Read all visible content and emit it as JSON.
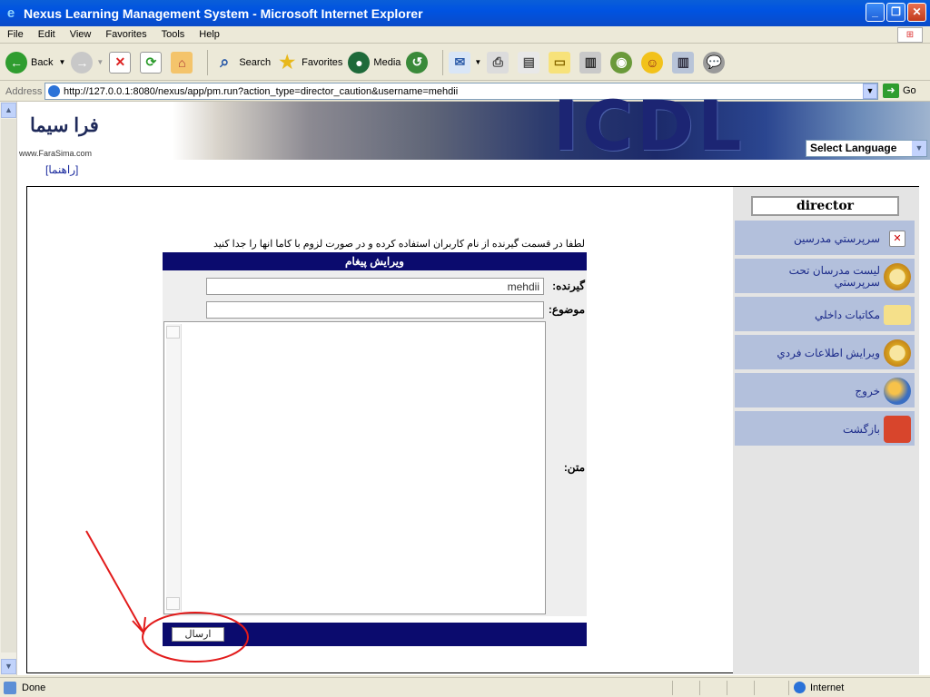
{
  "window": {
    "title": "Nexus Learning Management System - Microsoft Internet Explorer",
    "icon": "ie-icon"
  },
  "menu": [
    "File",
    "Edit",
    "View",
    "Favorites",
    "Tools",
    "Help"
  ],
  "toolbar": {
    "back": "Back",
    "search": "Search",
    "favorites": "Favorites",
    "media": "Media"
  },
  "address": {
    "label": "Address",
    "url": "http://127.0.0.1:8080/nexus/app/pm.run?action_type=director_caution&username=mehdii",
    "go": "Go"
  },
  "banner": {
    "logo_text": "فرا سیما",
    "logo_url": "www.FaraSima.com",
    "brand": "ICDL",
    "language_select": "Select Language"
  },
  "help_link": "[راهنما]",
  "sidebar": {
    "role": "director",
    "items": [
      {
        "label": "سرپرستي مدرسين",
        "icon": "close-box-icon"
      },
      {
        "label": "ليست مدرسان تحت سرپرستي",
        "icon": "magnifier-icon"
      },
      {
        "label": "مکاتبات داخلي",
        "icon": "envelope-icon"
      },
      {
        "label": "ويرايش اطلاعات فردي",
        "icon": "magnifier-icon"
      },
      {
        "label": "خروج",
        "icon": "exit-icon"
      },
      {
        "label": "بازگشت",
        "icon": "home-icon"
      }
    ]
  },
  "form": {
    "hint": "لطفا در قسمت گيرنده از نام کاربران استفاده کرده و در صورت لزوم با کاما انها را جدا کنيد",
    "title": "ويرايش پيغام",
    "recipient_label": "گيرنده:",
    "recipient_value": "mehdii",
    "subject_label": "موضوع:",
    "subject_value": "",
    "body_label": "متن:",
    "body_value": "",
    "send_label": "ارسال"
  },
  "status": {
    "text": "Done",
    "zone": "Internet"
  },
  "colors": {
    "title_bar": "#0053e1",
    "form_header": "#0b0b6e",
    "nav_item": "#b3c0dc",
    "annotation": "#e21b1b"
  }
}
